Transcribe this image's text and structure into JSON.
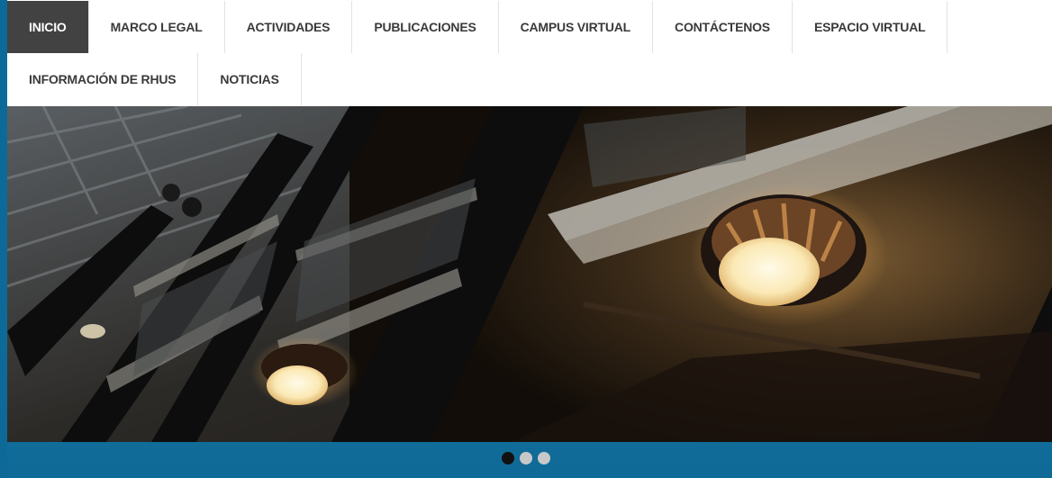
{
  "nav": {
    "row1": [
      {
        "label": "INICIO",
        "name": "nav-item-inicio",
        "active": true
      },
      {
        "label": "MARCO LEGAL",
        "name": "nav-item-marco-legal"
      },
      {
        "label": "ACTIVIDADES",
        "name": "nav-item-actividades"
      },
      {
        "label": "PUBLICACIONES",
        "name": "nav-item-publicaciones"
      },
      {
        "label": "CAMPUS VIRTUAL",
        "name": "nav-item-campus-virtual"
      },
      {
        "label": "CONTÁCTENOS",
        "name": "nav-item-contactenos"
      },
      {
        "label": "ESPACIO VIRTUAL",
        "name": "nav-item-espacio-virtual"
      }
    ],
    "row2": [
      {
        "label": "INFORMACIÓN DE RHUS",
        "name": "nav-item-informacion-de-rhus"
      },
      {
        "label": "NOTICIAS",
        "name": "nav-item-noticias"
      }
    ]
  },
  "slider": {
    "slide_count": 3,
    "active_index": 0
  },
  "colors": {
    "background": "#0f6f9c",
    "nav_active_bg": "#424242",
    "dot_active": "#111111",
    "dot_inactive": "#c8c8c8"
  }
}
